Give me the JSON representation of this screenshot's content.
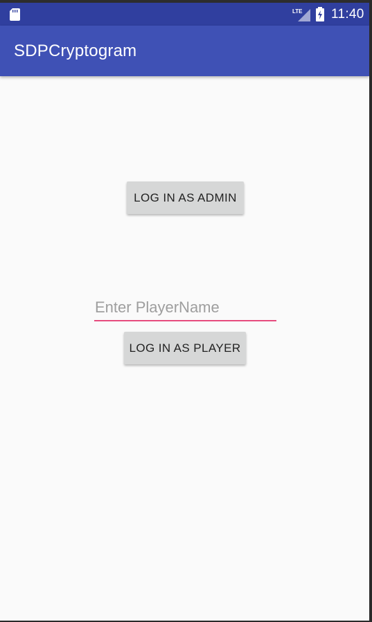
{
  "status_bar": {
    "time": "11:40",
    "network_label": "LTE",
    "icons": [
      "sd-card-icon",
      "lte-signal-icon",
      "battery-charging-icon"
    ]
  },
  "app_bar": {
    "title": "SDPCryptogram"
  },
  "main": {
    "admin_button_label": "LOG IN AS ADMIN",
    "player_name": {
      "value": "",
      "placeholder": "Enter PlayerName"
    },
    "player_button_label": "LOG IN AS PLAYER"
  },
  "colors": {
    "status_bar": "#303f9f",
    "app_bar": "#3f51b5",
    "accent": "#e64a7d",
    "background": "#fafafa",
    "button": "#d6d7d7"
  }
}
